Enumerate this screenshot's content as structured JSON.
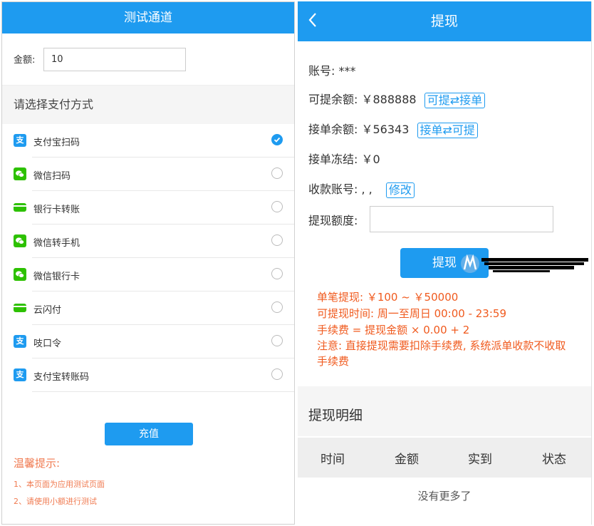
{
  "left": {
    "header_title": "测试通道",
    "amount_label": "金额:",
    "amount_value": "10",
    "section_title": "请选择支付方式",
    "pay_methods": [
      {
        "label": "支付宝扫码",
        "icon": "alipay-icon",
        "checked": true
      },
      {
        "label": "微信扫码",
        "icon": "wechat-icon",
        "checked": false
      },
      {
        "label": "银行卡转账",
        "icon": "bank-card-icon",
        "checked": false
      },
      {
        "label": "微信转手机",
        "icon": "wechat-icon",
        "checked": false
      },
      {
        "label": "微信银行卡",
        "icon": "wechat-icon",
        "checked": false
      },
      {
        "label": "云闪付",
        "icon": "bank-card-icon",
        "checked": false
      },
      {
        "label": "吱口令",
        "icon": "alipay-icon",
        "checked": false
      },
      {
        "label": "支付宝转账码",
        "icon": "alipay-icon",
        "checked": false
      }
    ],
    "recharge_label": "充值",
    "tips_title": "温馨提示:",
    "tips": [
      "1、本页面为应用测试页面",
      "2、请使用小额进行测试"
    ]
  },
  "right": {
    "back_icon": "chevron-left-icon",
    "header_title": "提现",
    "account_label": "账号:",
    "account_value": "***",
    "available_label": "可提余额:",
    "available_value": "￥888888",
    "available_btn": "可提⇄接单",
    "order_label": "接单余额:",
    "order_value": "￥56343",
    "order_btn": "接单⇄可提",
    "frozen_label": "接单冻结:",
    "frozen_value": "￥0",
    "receive_label": "收款账号:",
    "receive_value": ", ,",
    "modify_btn": "修改",
    "withdraw_label": "提现额度:",
    "withdraw_value": "",
    "submit_label": "提现",
    "rules": [
      "单笔提现: ￥100 ~ ￥50000",
      "可提现时间: 周一至周日 00:00 - 23:59",
      "手续费 = 提现金额 × 0.00 + 2",
      "注意: 直接提现需要扣除手续费, 系统派单收款不收取手续费"
    ],
    "detail_title": "提现明细",
    "columns": [
      "时间",
      "金额",
      "实到",
      "状态"
    ],
    "empty_text": "没有更多了"
  },
  "colors": {
    "accent": "#1e9bf0",
    "warning": "#f05a1e",
    "wechat": "#2dc100"
  }
}
